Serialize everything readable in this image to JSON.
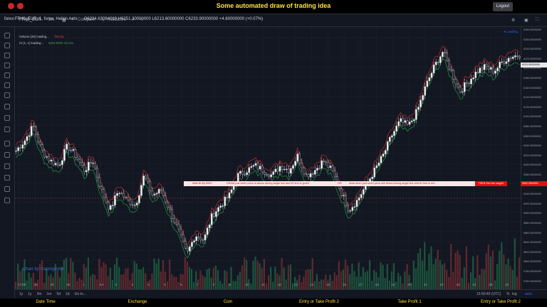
{
  "page": {
    "title": "Some automated draw of trading idea",
    "logout": "Logout"
  },
  "toolbar": {
    "symbol": "FR40_EUR",
    "interval": "1m",
    "compare": "Compare",
    "indicators": "Indicators"
  },
  "legend": {
    "main": "forex:FR40_EUR, 1, forex, Heikin Ashi",
    "ohlc": "O6234.63084019  H6251.30000000  L6213.60000000  C6233.90000000  +4.60000000 (+0.07%)",
    "volume": "Volume (20) loading...",
    "volume_vals": "7M   n/a",
    "ai": "AI (1, 1) loading...",
    "ai_vals": "6234.5500   n/a   n/a",
    "loading": "Loading"
  },
  "price_axis": [
    "6280.00000000",
    "6260.00000000",
    "6240.00000000",
    "6220.00000000",
    "6200.00000000",
    "6180.00000000",
    "6160.00000000",
    "6140.00000000",
    "6120.00000000",
    "6100.00000000",
    "6080.00000000",
    "6060.00000000",
    "6040.00000000",
    "6020.00000000",
    "6000.00000000",
    "5980.00000000",
    "5960.00000000",
    "5940.00000000",
    "5920.00000000",
    "5900.00000000",
    "5880.00000000",
    "5860.00000000",
    "5840.00000000",
    "5820.00000000",
    "5800.00000000",
    "5780.00000000",
    "5760.00000000"
  ],
  "price_tags": {
    "current": "6233.90000000",
    "line": "5951.25e9991"
  },
  "time_axis": [
    "17:00",
    "28",
    "29",
    "30",
    "1",
    "Jul",
    "2",
    "3",
    "4",
    "5",
    "6",
    "7",
    "8",
    "9",
    "10",
    "11",
    "12",
    "13",
    "14",
    "15",
    "16",
    "17",
    "18",
    "19",
    "20",
    "21",
    "22",
    "23",
    "24",
    "25",
    "15"
  ],
  "annotation": {
    "seg1": "Wait till flip 5900",
    "seg2": "DRAW just when price is above strong angle line and 81 line is green",
    "seg3": "OR",
    "seg4": "draw short just when price still below strong angle line and 81 line is red",
    "tag": "THEN See the magic!!"
  },
  "bottom_bar": {
    "ranges": [
      "1y",
      "1y",
      "3m",
      "1m",
      "5d",
      "1d",
      "Go to..."
    ],
    "time": "15:50:49 (UTC)",
    "pct": "%",
    "log": "log",
    "auto": "auto"
  },
  "watermark": "Chart by TradingView",
  "footer": [
    "Date Time",
    "Exchange",
    "Coin",
    "Entry or Take Profit 2",
    "Take Profit 1",
    "Entry or Take Profit 2"
  ],
  "chart_data": {
    "type": "candlestick",
    "title": "forex:FR40_EUR, 1, forex, Heikin Ashi",
    "ylim": [
      5760,
      6290
    ],
    "close_approx": [
      6040,
      6060,
      6090,
      6040,
      6020,
      6010,
      6050,
      6030,
      6000,
      6020,
      5960,
      5920,
      5960,
      5940,
      5930,
      5990,
      5950,
      5960,
      5920,
      5880,
      5830,
      5870,
      5860,
      5910,
      5930,
      5950,
      5990,
      6000,
      6010,
      6000,
      5990,
      6010,
      6000,
      6030,
      5990,
      6000,
      6020,
      6000,
      5960,
      5920,
      5940,
      5970,
      6000,
      6030,
      6070,
      6100,
      6090,
      6120,
      6170,
      6210,
      6240,
      6200,
      6160,
      6180,
      6200,
      6210,
      6200,
      6220,
      6230,
      6234
    ]
  }
}
